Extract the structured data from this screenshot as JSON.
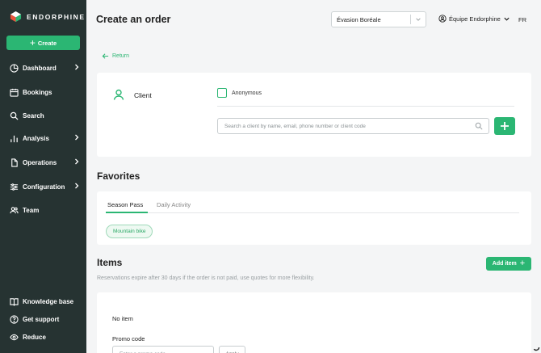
{
  "app": {
    "brand": "ENDORPHINE"
  },
  "sidebar": {
    "create_label": "Create",
    "items": [
      {
        "label": "Dashboard",
        "icon": "pie-chart-icon"
      },
      {
        "label": "Bookings",
        "icon": "calendar-icon"
      },
      {
        "label": "Search",
        "icon": "search-icon"
      },
      {
        "label": "Analysis",
        "icon": "bar-chart-icon"
      },
      {
        "label": "Operations",
        "icon": "document-icon"
      },
      {
        "label": "Configuration",
        "icon": "sliders-icon"
      },
      {
        "label": "Team",
        "icon": "users-icon"
      }
    ],
    "bottom": [
      {
        "label": "Knowledge base",
        "icon": "book-icon"
      },
      {
        "label": "Get support",
        "icon": "help-icon"
      },
      {
        "label": "Reduce",
        "icon": "eye-icon"
      }
    ]
  },
  "header": {
    "title": "Create an order",
    "organization": "Évasion Boréale",
    "team": "Équipe Endorphine",
    "language": "FR"
  },
  "return_label": "Return",
  "client": {
    "label": "Client",
    "anonymous_label": "Anonymous",
    "search_placeholder": "Search a client by name, email, phone number or client code"
  },
  "favorites": {
    "title": "Favorites",
    "tabs": [
      {
        "label": "Season Pass",
        "active": true
      },
      {
        "label": "Daily Activity",
        "active": false
      }
    ],
    "chips": [
      "Mountain bike"
    ]
  },
  "items": {
    "title": "Items",
    "add_label": "Add item",
    "note": "Reservations expire after 30 days if the order is not paid, use quotes for more flexibility.",
    "empty_label": "No item",
    "promo_label": "Promo code",
    "promo_placeholder": "Enter a promo code",
    "promo_apply": "Apply"
  },
  "colors": {
    "accent": "#2bb673",
    "sidebar": "#263332",
    "background": "#f4f5f6"
  }
}
